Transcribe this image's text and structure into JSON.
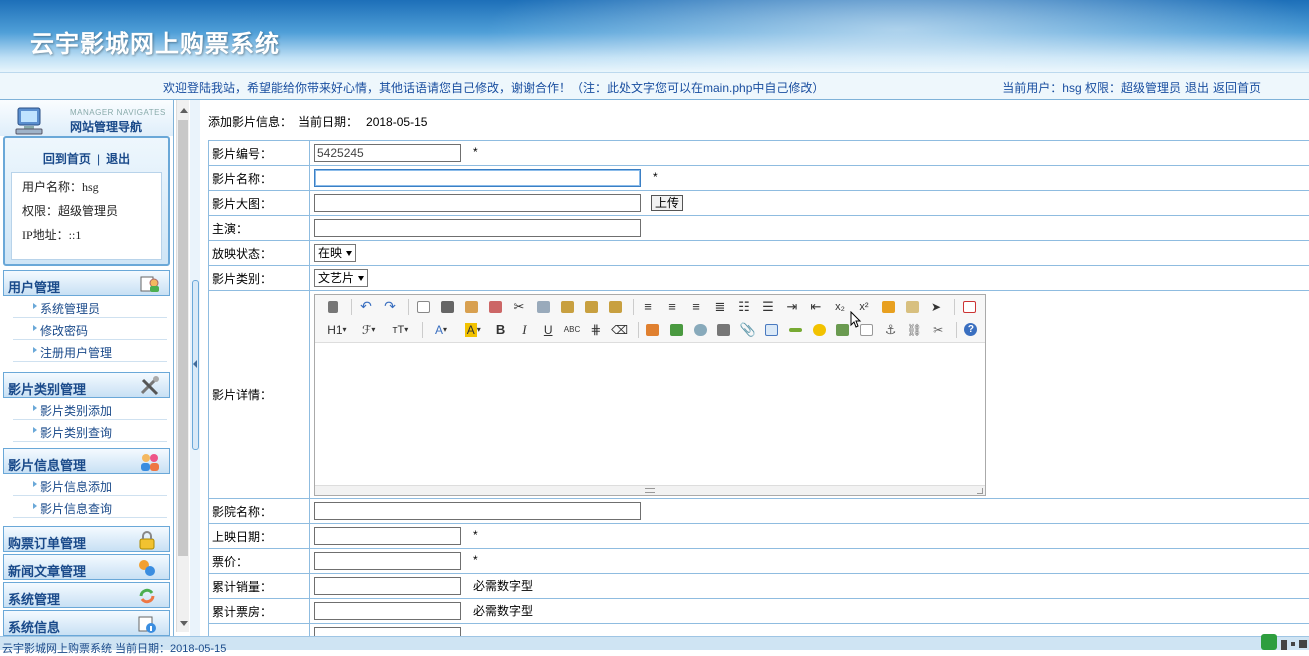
{
  "banner": {
    "title": "云宇影城网上购票系统"
  },
  "welcome": {
    "message": "欢迎登陆我站，希望能给你带来好心情，其他话语请您自己修改，谢谢合作！（注：此处文字您可以在main.php中自己修改）",
    "current_user_label": "当前用户：hsg 权限：超级管理员",
    "logout": "退出",
    "back_home": "返回首页"
  },
  "sidebar": {
    "header_sub": "MANAGER NAVIGATES",
    "header_main": "网站管理导航",
    "home_link": "回到首页",
    "sep": "|",
    "logout_link": "退出",
    "user_name": "用户名称：hsg",
    "permission": "权限：超级管理员",
    "ip": "IP地址：::1",
    "sections": [
      {
        "title": "用户管理",
        "items": [
          "系统管理员",
          "修改密码",
          "注册用户管理"
        ]
      },
      {
        "title": "影片类别管理",
        "items": [
          "影片类别添加",
          "影片类别查询"
        ]
      },
      {
        "title": "影片信息管理",
        "items": [
          "影片信息添加",
          "影片信息查询"
        ]
      }
    ],
    "collapsed": [
      "购票订单管理",
      "新闻文章管理",
      "系统管理",
      "系统信息"
    ]
  },
  "content": {
    "crumb": "添加影片信息：",
    "date_label": "当前日期：",
    "date": "2018-05-15",
    "fields": {
      "code": {
        "label": "影片编号：",
        "value": "5425245",
        "star": "*"
      },
      "name": {
        "label": "影片名称：",
        "value": "",
        "star": "*"
      },
      "poster": {
        "label": "影片大图：",
        "value": "",
        "button": "上传"
      },
      "actor": {
        "label": "主演：",
        "value": ""
      },
      "status": {
        "label": "放映状态：",
        "selected": "在映"
      },
      "category": {
        "label": "影片类别：",
        "selected": "文艺片"
      },
      "detail": {
        "label": "影片详情："
      },
      "cinema": {
        "label": "影院名称：",
        "value": ""
      },
      "release": {
        "label": "上映日期：",
        "value": "",
        "star": "*"
      },
      "price": {
        "label": "票价：",
        "value": "",
        "star": "*"
      },
      "sales": {
        "label": "累计销量：",
        "value": "",
        "hint": "必需数字型"
      },
      "boxoffice": {
        "label": "累计票房：",
        "value": "",
        "hint": "必需数字型"
      }
    },
    "editor_toolbar": {
      "h1": "H1",
      "font": "ℱ",
      "size": "тT",
      "bold": "B",
      "italic": "I",
      "underline": "U",
      "abc": "ABC",
      "subscript": "x₂",
      "superscript": "x²",
      "help": "?"
    }
  },
  "footer": {
    "text": "云宇影城网上购票系统 当前日期：2018-05-15"
  },
  "colors": {
    "brand": "#1d6fb8",
    "border": "#8fbce0",
    "link": "#1a4a8a"
  }
}
